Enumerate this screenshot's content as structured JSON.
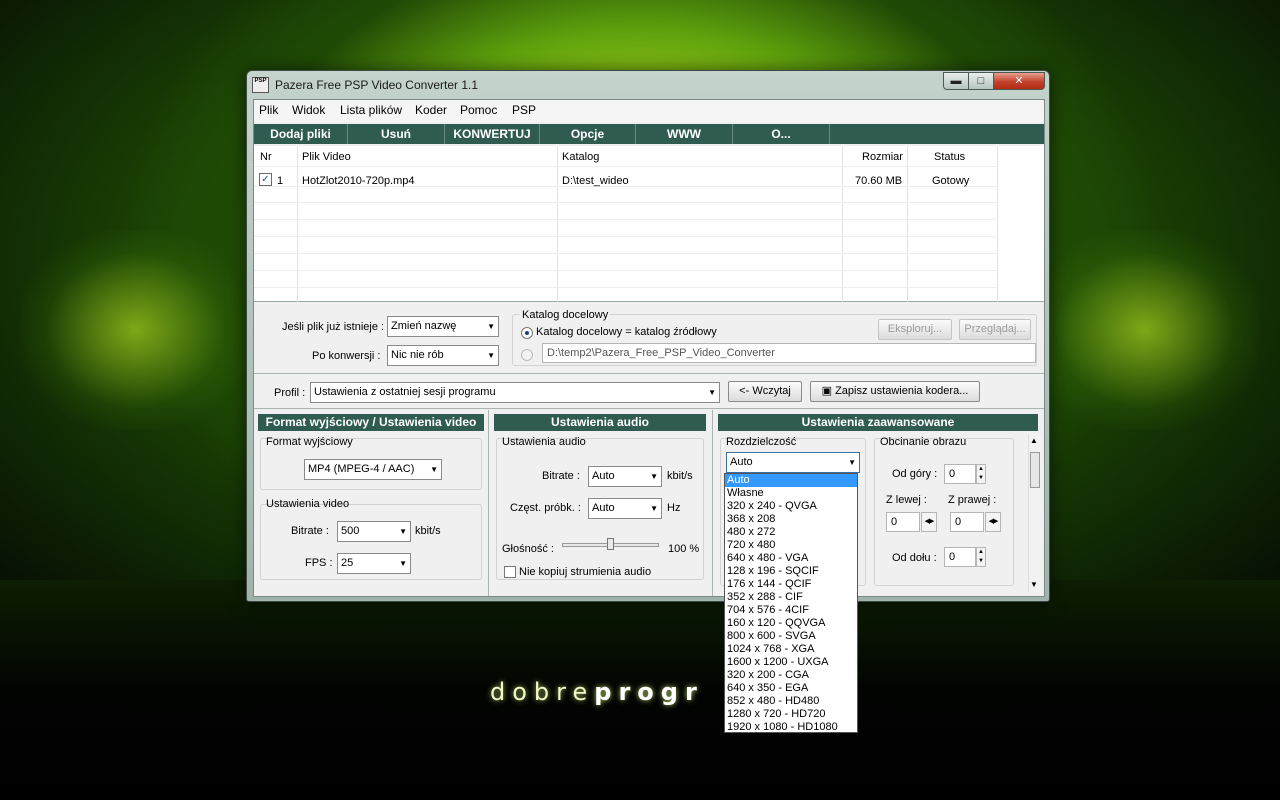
{
  "window": {
    "title": "Pazera Free PSP Video Converter 1.1",
    "icon_text": "PSP",
    "minimize": "▬",
    "maximize": "□",
    "close": "✕"
  },
  "watermark": {
    "light": "dobre",
    "bold": "progr"
  },
  "menu": [
    "Plik",
    "Widok",
    "Lista plików",
    "Koder",
    "Pomoc",
    "PSP"
  ],
  "toolbar": [
    "Dodaj pliki",
    "Usuń",
    "KONWERTUJ",
    "Opcje",
    "WWW",
    "O..."
  ],
  "filelist": {
    "headers": {
      "nr": "Nr",
      "file": "Plik Video",
      "dir": "Katalog",
      "size": "Rozmiar",
      "status": "Status"
    },
    "rows": [
      {
        "checked": true,
        "check_mark": "✓",
        "nr": "1",
        "file": "HotZlot2010-720p.mp4",
        "dir": "D:\\test_wideo",
        "size": "70.60 MB",
        "status": "Gotowy"
      }
    ]
  },
  "options": {
    "if_exists_label": "Jeśli plik już istnieje :",
    "if_exists_value": "Zmień nazwę",
    "after_conversion_label": "Po konwersji :",
    "after_conversion_value": "Nic nie rób",
    "target_dir_group": "Katalog docelowy",
    "target_same_label": "Katalog docelowy = katalog źródłowy",
    "explore_button": "Eksploruj...",
    "browse_button": "Przeglądaj...",
    "target_dir_path": "D:\\temp2\\Pazera_Free_PSP_Video_Converter"
  },
  "profile": {
    "label": "Profil :",
    "value": "Ustawienia z ostatniej sesji programu",
    "load_button": "<- Wczytaj",
    "save_button": "Zapisz ustawienia kodera..."
  },
  "video_panel": {
    "header": "Format wyjściowy / Ustawienia video",
    "format_group": "Format wyjściowy",
    "format_value": "MP4 (MPEG-4 / AAC)",
    "video_group": "Ustawienia video",
    "bitrate_label": "Bitrate :",
    "bitrate_value": "500",
    "bitrate_unit": "kbit/s",
    "fps_label": "FPS :",
    "fps_value": "25"
  },
  "audio_panel": {
    "header": "Ustawienia audio",
    "group": "Ustawienia audio",
    "bitrate_label": "Bitrate :",
    "bitrate_value": "Auto",
    "bitrate_unit": "kbit/s",
    "sample_label": "Częst. próbk. :",
    "sample_value": "Auto",
    "sample_unit": "Hz",
    "volume_label": "Głośność :",
    "volume_value": "100 %",
    "volume_level": 0.5,
    "nocopy_label": "Nie kopiuj strumienia audio"
  },
  "advanced_panel": {
    "header": "Ustawienia zaawansowane",
    "resolution_group": "Rozdzielczość",
    "resolution_value": "Auto",
    "crop_group": "Obcinanie obrazu",
    "top_label": "Od góry :",
    "top_value": "0",
    "left_label": "Z lewej :",
    "left_value": "0",
    "right_label": "Z prawej :",
    "right_value": "0",
    "bottom_label": "Od dołu :",
    "bottom_value": "0"
  },
  "resolution_options": [
    "Auto",
    "Własne",
    "320 x 240 - QVGA",
    "368 x 208",
    "480 x 272",
    "720 x 480",
    "640 x 480 - VGA",
    "128 x 196 - SQCIF",
    "176 x 144 - QCIF",
    "352 x 288 - CIF",
    "704 x 576 - 4CIF",
    "160 x 120 - QQVGA",
    "800 x 600 - SVGA",
    "1024 x 768 - XGA",
    "1600 x 1200 - UXGA",
    "320 x 200 - CGA",
    "640 x 350 - EGA",
    "852 x 480 - HD480",
    "1280 x 720 - HD720",
    "1920 x 1080 - HD1080"
  ],
  "resolution_selected": "Auto",
  "icons": {
    "dropdown_arrow": "▼",
    "spin_up": "▲",
    "spin_down": "▼",
    "spin_left": "◀",
    "spin_right": "▶",
    "save": "▣"
  }
}
